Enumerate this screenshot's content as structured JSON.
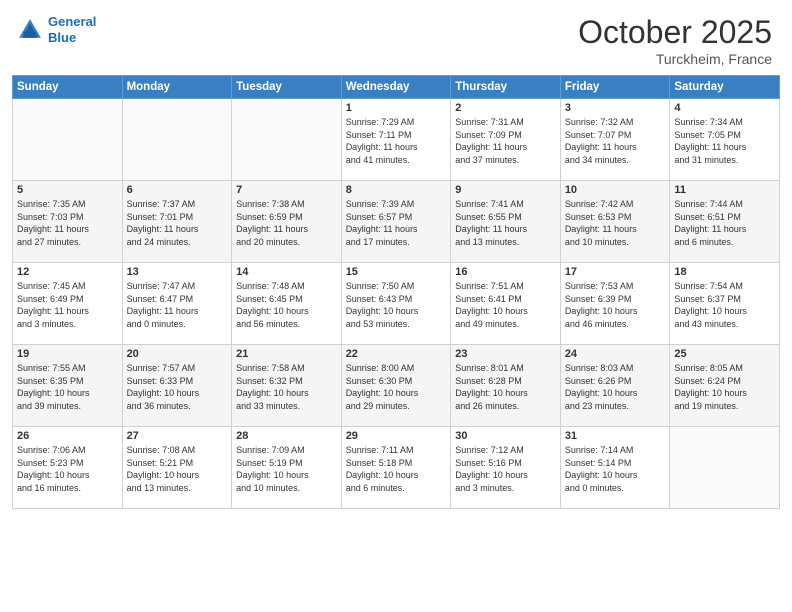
{
  "header": {
    "logo_line1": "General",
    "logo_line2": "Blue",
    "month": "October 2025",
    "location": "Turckheim, France"
  },
  "days_of_week": [
    "Sunday",
    "Monday",
    "Tuesday",
    "Wednesday",
    "Thursday",
    "Friday",
    "Saturday"
  ],
  "weeks": [
    [
      {
        "day": "",
        "info": ""
      },
      {
        "day": "",
        "info": ""
      },
      {
        "day": "",
        "info": ""
      },
      {
        "day": "1",
        "info": "Sunrise: 7:29 AM\nSunset: 7:11 PM\nDaylight: 11 hours\nand 41 minutes."
      },
      {
        "day": "2",
        "info": "Sunrise: 7:31 AM\nSunset: 7:09 PM\nDaylight: 11 hours\nand 37 minutes."
      },
      {
        "day": "3",
        "info": "Sunrise: 7:32 AM\nSunset: 7:07 PM\nDaylight: 11 hours\nand 34 minutes."
      },
      {
        "day": "4",
        "info": "Sunrise: 7:34 AM\nSunset: 7:05 PM\nDaylight: 11 hours\nand 31 minutes."
      }
    ],
    [
      {
        "day": "5",
        "info": "Sunrise: 7:35 AM\nSunset: 7:03 PM\nDaylight: 11 hours\nand 27 minutes."
      },
      {
        "day": "6",
        "info": "Sunrise: 7:37 AM\nSunset: 7:01 PM\nDaylight: 11 hours\nand 24 minutes."
      },
      {
        "day": "7",
        "info": "Sunrise: 7:38 AM\nSunset: 6:59 PM\nDaylight: 11 hours\nand 20 minutes."
      },
      {
        "day": "8",
        "info": "Sunrise: 7:39 AM\nSunset: 6:57 PM\nDaylight: 11 hours\nand 17 minutes."
      },
      {
        "day": "9",
        "info": "Sunrise: 7:41 AM\nSunset: 6:55 PM\nDaylight: 11 hours\nand 13 minutes."
      },
      {
        "day": "10",
        "info": "Sunrise: 7:42 AM\nSunset: 6:53 PM\nDaylight: 11 hours\nand 10 minutes."
      },
      {
        "day": "11",
        "info": "Sunrise: 7:44 AM\nSunset: 6:51 PM\nDaylight: 11 hours\nand 6 minutes."
      }
    ],
    [
      {
        "day": "12",
        "info": "Sunrise: 7:45 AM\nSunset: 6:49 PM\nDaylight: 11 hours\nand 3 minutes."
      },
      {
        "day": "13",
        "info": "Sunrise: 7:47 AM\nSunset: 6:47 PM\nDaylight: 11 hours\nand 0 minutes."
      },
      {
        "day": "14",
        "info": "Sunrise: 7:48 AM\nSunset: 6:45 PM\nDaylight: 10 hours\nand 56 minutes."
      },
      {
        "day": "15",
        "info": "Sunrise: 7:50 AM\nSunset: 6:43 PM\nDaylight: 10 hours\nand 53 minutes."
      },
      {
        "day": "16",
        "info": "Sunrise: 7:51 AM\nSunset: 6:41 PM\nDaylight: 10 hours\nand 49 minutes."
      },
      {
        "day": "17",
        "info": "Sunrise: 7:53 AM\nSunset: 6:39 PM\nDaylight: 10 hours\nand 46 minutes."
      },
      {
        "day": "18",
        "info": "Sunrise: 7:54 AM\nSunset: 6:37 PM\nDaylight: 10 hours\nand 43 minutes."
      }
    ],
    [
      {
        "day": "19",
        "info": "Sunrise: 7:55 AM\nSunset: 6:35 PM\nDaylight: 10 hours\nand 39 minutes."
      },
      {
        "day": "20",
        "info": "Sunrise: 7:57 AM\nSunset: 6:33 PM\nDaylight: 10 hours\nand 36 minutes."
      },
      {
        "day": "21",
        "info": "Sunrise: 7:58 AM\nSunset: 6:32 PM\nDaylight: 10 hours\nand 33 minutes."
      },
      {
        "day": "22",
        "info": "Sunrise: 8:00 AM\nSunset: 6:30 PM\nDaylight: 10 hours\nand 29 minutes."
      },
      {
        "day": "23",
        "info": "Sunrise: 8:01 AM\nSunset: 6:28 PM\nDaylight: 10 hours\nand 26 minutes."
      },
      {
        "day": "24",
        "info": "Sunrise: 8:03 AM\nSunset: 6:26 PM\nDaylight: 10 hours\nand 23 minutes."
      },
      {
        "day": "25",
        "info": "Sunrise: 8:05 AM\nSunset: 6:24 PM\nDaylight: 10 hours\nand 19 minutes."
      }
    ],
    [
      {
        "day": "26",
        "info": "Sunrise: 7:06 AM\nSunset: 5:23 PM\nDaylight: 10 hours\nand 16 minutes."
      },
      {
        "day": "27",
        "info": "Sunrise: 7:08 AM\nSunset: 5:21 PM\nDaylight: 10 hours\nand 13 minutes."
      },
      {
        "day": "28",
        "info": "Sunrise: 7:09 AM\nSunset: 5:19 PM\nDaylight: 10 hours\nand 10 minutes."
      },
      {
        "day": "29",
        "info": "Sunrise: 7:11 AM\nSunset: 5:18 PM\nDaylight: 10 hours\nand 6 minutes."
      },
      {
        "day": "30",
        "info": "Sunrise: 7:12 AM\nSunset: 5:16 PM\nDaylight: 10 hours\nand 3 minutes."
      },
      {
        "day": "31",
        "info": "Sunrise: 7:14 AM\nSunset: 5:14 PM\nDaylight: 10 hours\nand 0 minutes."
      },
      {
        "day": "",
        "info": ""
      }
    ]
  ]
}
